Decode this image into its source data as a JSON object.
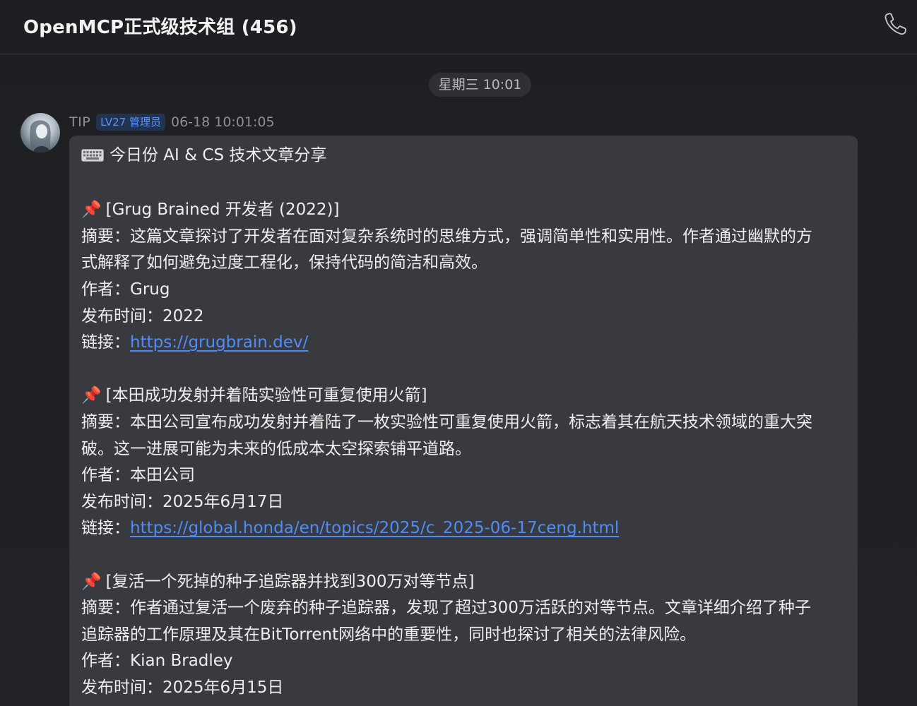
{
  "header": {
    "title": "OpenMCP正式级技术组 (456)"
  },
  "time_divider": "星期三 10:01",
  "message": {
    "sender": "TIP",
    "badge": "LV27 管理员",
    "timestamp": "06-18 10:01:05",
    "intro": "今日份 AI & CS 技术文章分享",
    "articles": [
      {
        "title": "[Grug Brained 开发者 (2022)]",
        "summary_label": "摘要：",
        "summary_line1": "这篇文章探讨了开发者在面对复杂系统时的思维方式，强调简单性和实用性。作者通过幽默的方",
        "summary_line2": "式解释了如何避免过度工程化，保持代码的简洁和高效。",
        "author_label": "作者：",
        "author": "Grug",
        "date_label": "发布时间：",
        "date": "2022",
        "link_label": "链接：",
        "link": "https://grugbrain.dev/"
      },
      {
        "title": "[本田成功发射并着陆实验性可重复使用火箭]",
        "summary_label": "摘要：",
        "summary_line1": "本田公司宣布成功发射并着陆了一枚实验性可重复使用火箭，标志着其在航天技术领域的重大突",
        "summary_line2": "破。这一进展可能为未来的低成本太空探索铺平道路。",
        "author_label": "作者：",
        "author": "本田公司",
        "date_label": "发布时间：",
        "date": "2025年6月17日",
        "link_label": "链接：",
        "link": "https://global.honda/en/topics/2025/c_2025-06-17ceng.html"
      },
      {
        "title": "[复活一个死掉的种子追踪器并找到300万对等节点]",
        "summary_label": "摘要：",
        "summary_line1": "作者通过复活一个废弃的种子追踪器，发现了超过300万活跃的对等节点。文章详细介绍了种子",
        "summary_line2": "追踪器的工作原理及其在BitTorrent网络中的重要性，同时也探讨了相关的法律风险。",
        "author_label": "作者：",
        "author": "Kian Bradley",
        "date_label": "发布时间：",
        "date": "2025年6月15日"
      }
    ]
  },
  "icons": {
    "call": "phone-icon",
    "intro": "keyboard-icon",
    "bullet": "pushpin-icon"
  },
  "colors": {
    "background": "#1f2024",
    "bubble": "#393a3f",
    "link": "#4e8cf7",
    "badge_text": "#5b93ff",
    "badge_bg": "#22334f"
  }
}
